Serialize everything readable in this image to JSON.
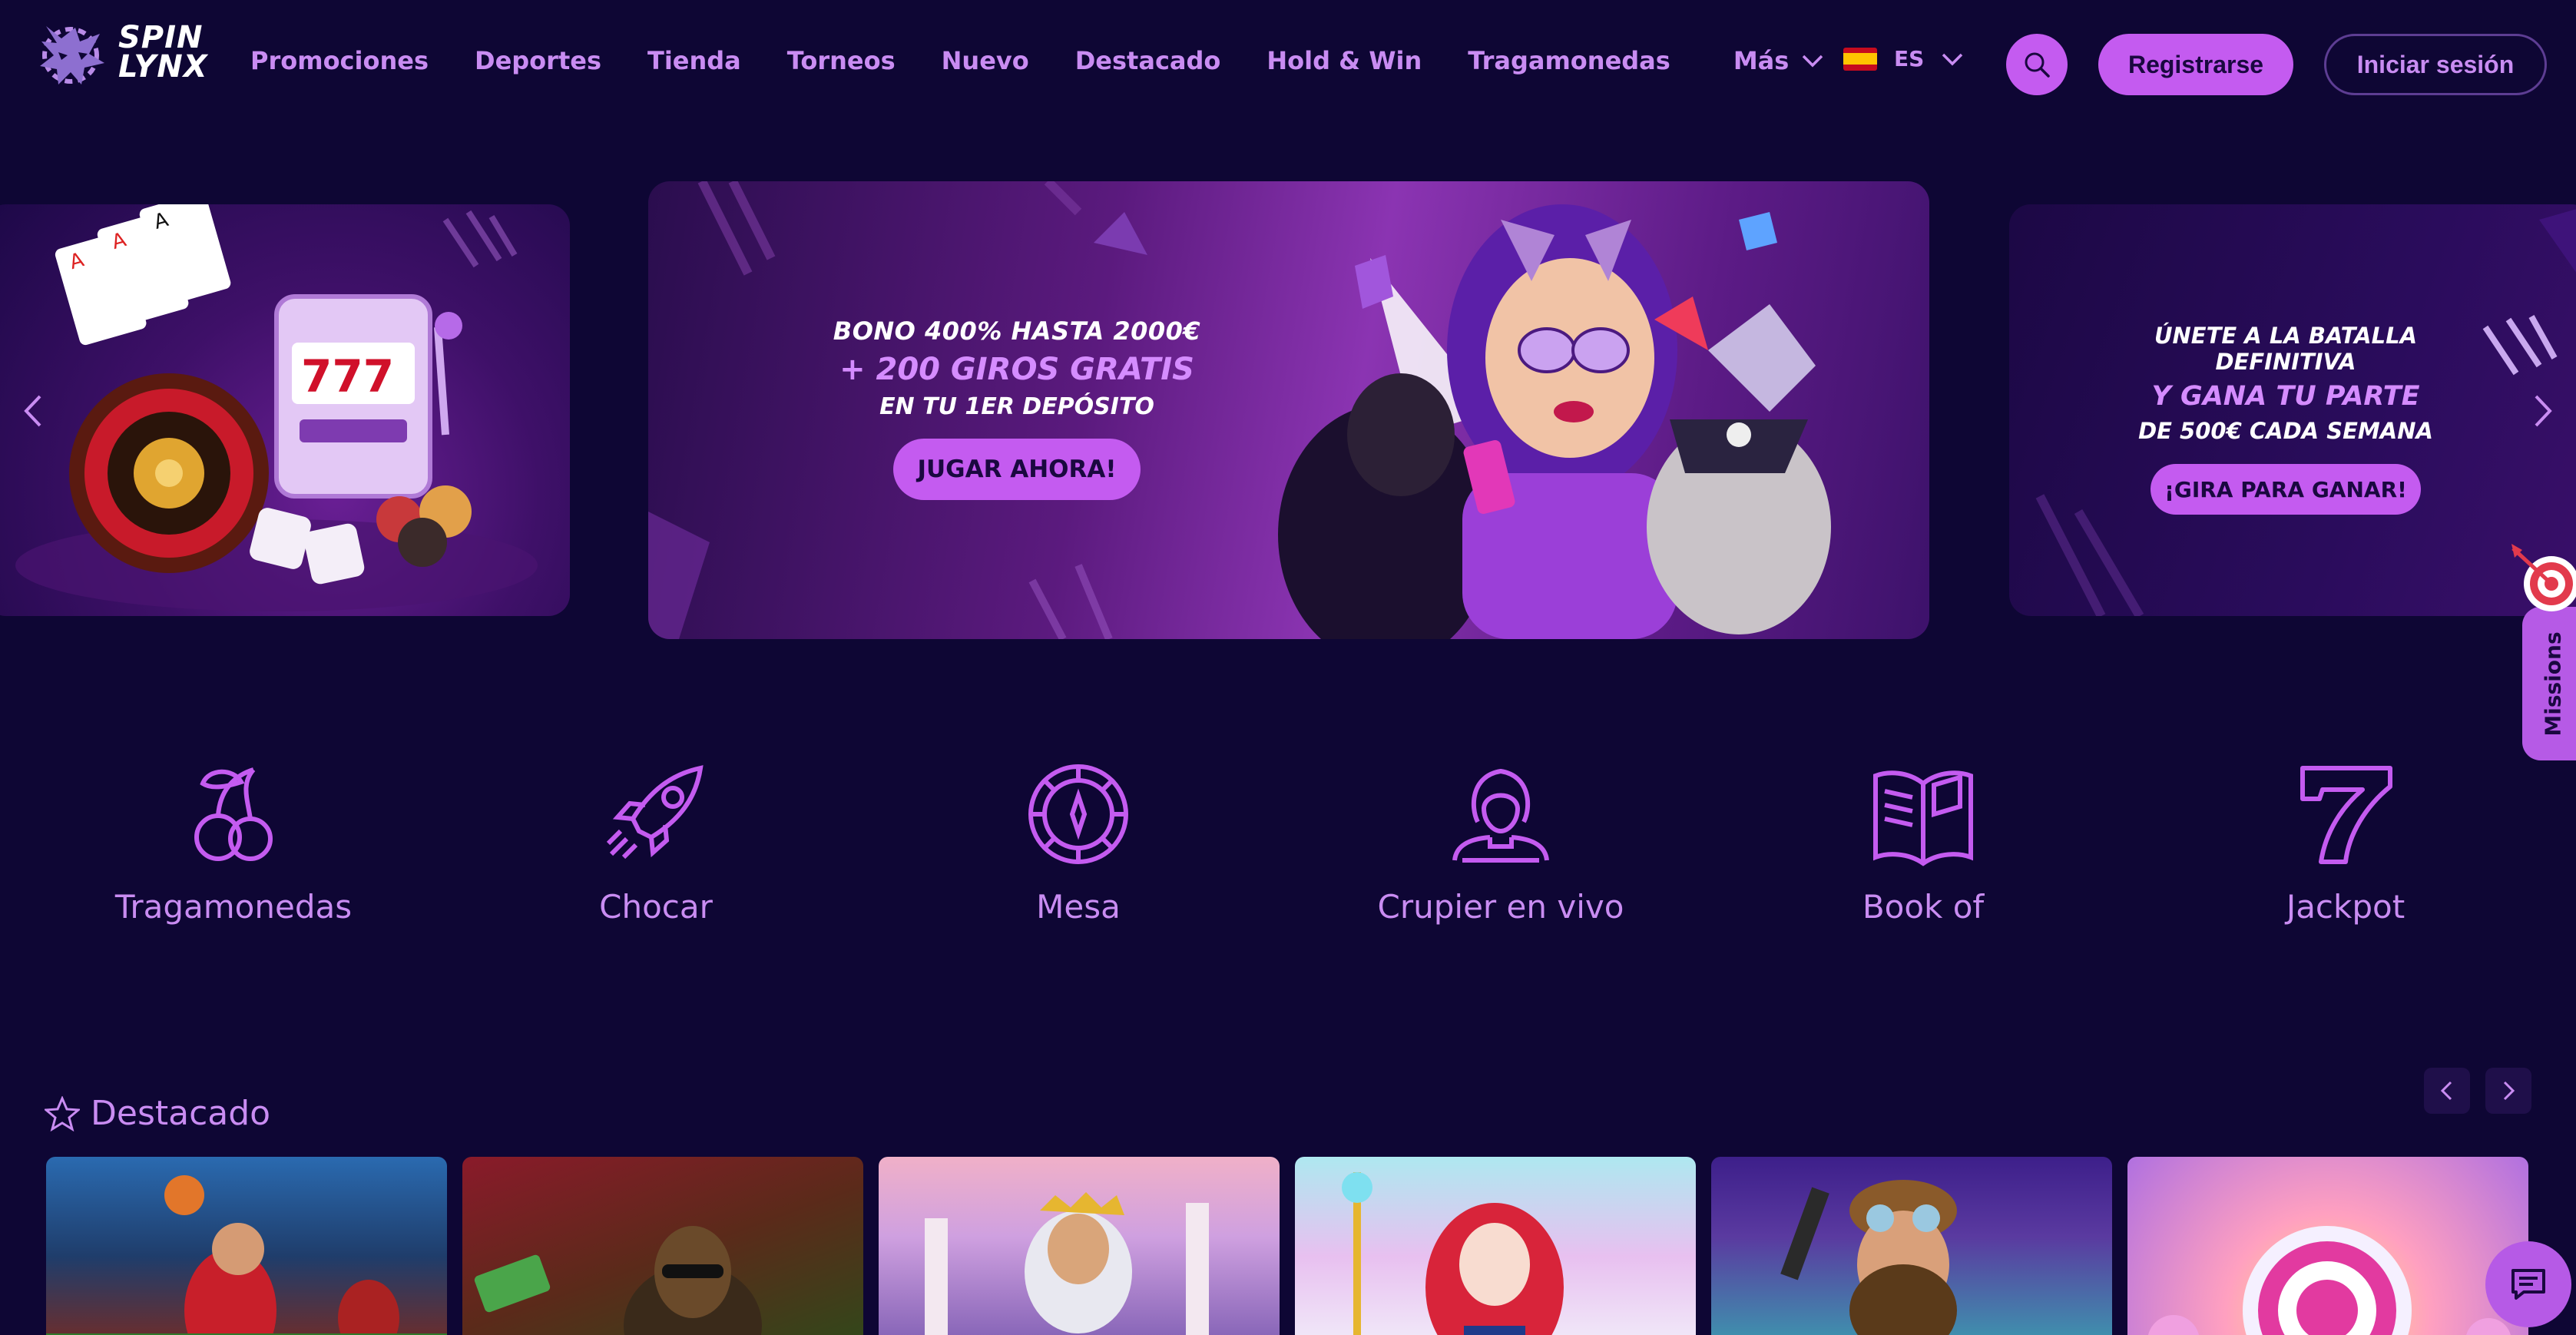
{
  "brand": {
    "line1": "SPIN",
    "line2": "LYNX",
    "accent_color": "#c45bf0"
  },
  "nav": {
    "items": [
      {
        "label": "Promociones"
      },
      {
        "label": "Deportes"
      },
      {
        "label": "Tienda"
      },
      {
        "label": "Torneos"
      },
      {
        "label": "Nuevo"
      },
      {
        "label": "Destacado"
      },
      {
        "label": "Hold & Win"
      },
      {
        "label": "Tragamonedas"
      }
    ],
    "more_label": "Más"
  },
  "language": {
    "code": "ES",
    "flag": "spain-flag-icon"
  },
  "actions": {
    "register_label": "Registrarse",
    "login_label": "Iniciar sesión"
  },
  "banners": {
    "main": {
      "line1": "BONO 400% HASTA 2000€",
      "line2": "+ 200 GIROS GRATIS",
      "line3": "EN TU 1ER DEPÓSITO",
      "cta": "JUGAR AHORA!"
    },
    "right": {
      "line1": "ÚNETE A LA BATALLA DEFINITIVA",
      "line2": "Y GANA TU PARTE",
      "line3": "DE 500€ CADA SEMANA",
      "cta": "¡GIRA PARA GANAR!"
    }
  },
  "missions": {
    "label": "Missions"
  },
  "categories": [
    {
      "label": "Tragamonedas",
      "icon": "cherries-icon"
    },
    {
      "label": "Chocar",
      "icon": "rocket-icon"
    },
    {
      "label": "Mesa",
      "icon": "roulette-icon"
    },
    {
      "label": "Crupier en vivo",
      "icon": "dealer-icon"
    },
    {
      "label": "Book of",
      "icon": "book-icon"
    },
    {
      "label": "Jackpot",
      "icon": "seven-icon"
    }
  ],
  "featured": {
    "title": "Destacado",
    "tiles": [
      {
        "name": "basketball-game-tile"
      },
      {
        "name": "money-game-tile"
      },
      {
        "name": "zeus-game-tile"
      },
      {
        "name": "anime-game-tile"
      },
      {
        "name": "pilot-game-tile"
      },
      {
        "name": "candy-game-tile"
      }
    ]
  }
}
